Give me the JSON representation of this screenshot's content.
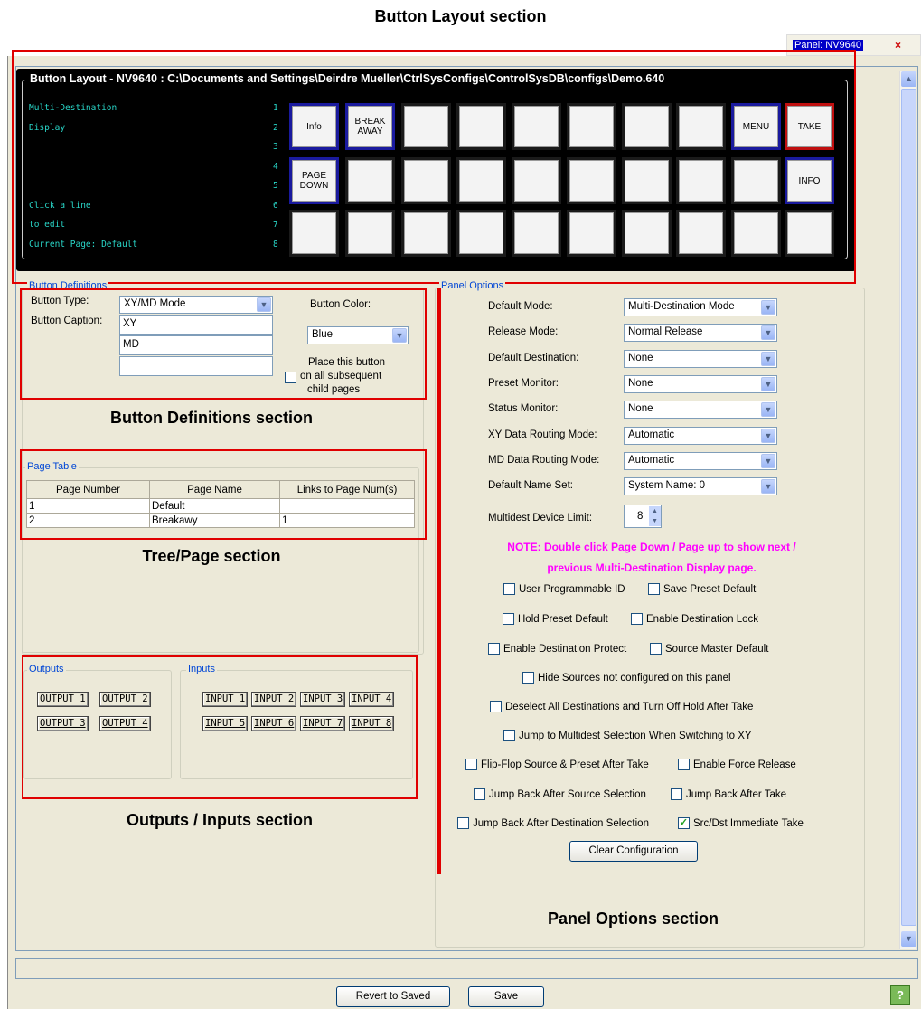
{
  "captions": {
    "button_layout": "Button Layout section",
    "button_definitions": "Button Definitions section",
    "tree_page": "Tree/Page section",
    "outputs_inputs": "Outputs / Inputs section",
    "panel_options": "Panel Options section"
  },
  "tab": {
    "label": "Panel: NV9640",
    "close": "×"
  },
  "button_layout": {
    "title": "Button Layout - NV9640 : C:\\Documents and Settings\\Deirdre Mueller\\CtrlSysConfigs\\ControlSysDB\\configs\\Demo.640",
    "display_lines": [
      "Multi-Destination",
      "Display",
      "",
      "",
      "",
      "Click a line",
      "to edit",
      "Current Page: Default"
    ],
    "line_numbers": [
      "1",
      "2",
      "3",
      "4",
      "5",
      "6",
      "7",
      "8"
    ],
    "row1": [
      "Info",
      "BREAK AWAY",
      "",
      "",
      "",
      "",
      "",
      "",
      "MENU",
      "TAKE"
    ],
    "row2": [
      "PAGE DOWN",
      "",
      "",
      "",
      "",
      "",
      "",
      "",
      "",
      "INFO"
    ],
    "row3": [
      "",
      "",
      "",
      "",
      "",
      "",
      "",
      "",
      "",
      ""
    ]
  },
  "button_definitions": {
    "group_title": "Button Definitions",
    "type_label": "Button Type:",
    "type_value": "XY/MD Mode",
    "caption_label": "Button Caption:",
    "caption1": "XY",
    "caption2": "MD",
    "caption3": "",
    "color_label": "Button Color:",
    "color_value": "Blue",
    "place_text": "Place this button",
    "place_text2": "on all subsequent",
    "place_text3": "child pages"
  },
  "page_table": {
    "title": "Page Table",
    "headers": [
      "Page Number",
      "Page Name",
      "Links to Page Num(s)"
    ],
    "rows": [
      [
        "1",
        "Default",
        ""
      ],
      [
        "2",
        "Breakawy",
        "1"
      ]
    ]
  },
  "outputs": {
    "title": "Outputs",
    "items": [
      "OUTPUT 1",
      "OUTPUT 2",
      "OUTPUT 3",
      "OUTPUT 4"
    ]
  },
  "inputs": {
    "title": "Inputs",
    "items": [
      "INPUT 1",
      "INPUT 2",
      "INPUT 3",
      "INPUT 4",
      "INPUT 5",
      "INPUT 6",
      "INPUT 7",
      "INPUT 8"
    ]
  },
  "panel_options": {
    "group_title": "Panel Options",
    "fields": [
      {
        "label": "Default Mode:",
        "value": "Multi-Destination Mode"
      },
      {
        "label": "Release Mode:",
        "value": "Normal Release"
      },
      {
        "label": "Default Destination:",
        "value": "None"
      },
      {
        "label": "Preset Monitor:",
        "value": "None"
      },
      {
        "label": "Status Monitor:",
        "value": "None"
      },
      {
        "label": "XY Data Routing Mode:",
        "value": "Automatic"
      },
      {
        "label": "MD Data Routing Mode:",
        "value": "Automatic"
      },
      {
        "label": "Default Name Set:",
        "value": "System Name: 0"
      }
    ],
    "limit_label": "Multidest Device Limit:",
    "limit_value": "8",
    "note1": "NOTE: Double click Page Down / Page up to show next /",
    "note2": "previous Multi-Destination Display page.",
    "checks": [
      "User Programmable ID",
      "Save Preset Default",
      "Hold Preset Default",
      "Enable Destination Lock",
      "Enable Destination Protect",
      "Source Master Default",
      "Hide Sources not configured on this panel",
      "Deselect All Destinations and Turn Off Hold After Take",
      "Jump to Multidest Selection When Switching to XY",
      "Flip-Flop Source & Preset After Take",
      "Enable Force Release",
      "Jump Back After Source Selection",
      "Jump Back After Take",
      "Jump Back After Destination Selection",
      "Src/Dst Immediate Take"
    ],
    "clear_button": "Clear Configuration"
  },
  "footer": {
    "revert": "Revert to Saved",
    "save": "Save"
  }
}
